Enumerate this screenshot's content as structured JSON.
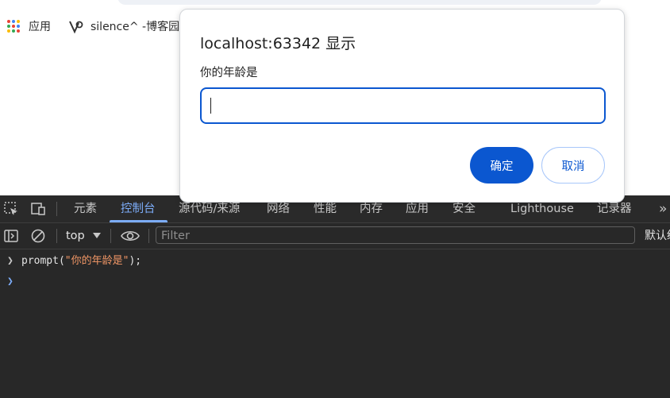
{
  "bookmarks": {
    "apps_label": "应用",
    "blog_label": "silence^ -博客园"
  },
  "dialog": {
    "title": "localhost:63342 显示",
    "message": "你的年龄是",
    "input_value": "",
    "ok_label": "确定",
    "cancel_label": "取消"
  },
  "devtools": {
    "tabs": [
      {
        "label": "元素"
      },
      {
        "label": "控制台"
      },
      {
        "label": "源代码/来源"
      },
      {
        "label": "网络"
      },
      {
        "label": "性能"
      },
      {
        "label": "内存"
      },
      {
        "label": "应用"
      },
      {
        "label": "安全"
      },
      {
        "label": "Lighthouse"
      },
      {
        "label": "记录器"
      }
    ],
    "more_tabs": "»",
    "context": "top",
    "filter_placeholder": "Filter",
    "levels": "默认级别",
    "console": {
      "entry_prefix": "prompt(",
      "entry_string": "\"你的年龄是\"",
      "entry_suffix": ");"
    }
  },
  "colors": {
    "accent": "#0b57d0",
    "devtools_bg": "#282828",
    "active_tab": "#7cacf8",
    "string": "#f29766"
  }
}
